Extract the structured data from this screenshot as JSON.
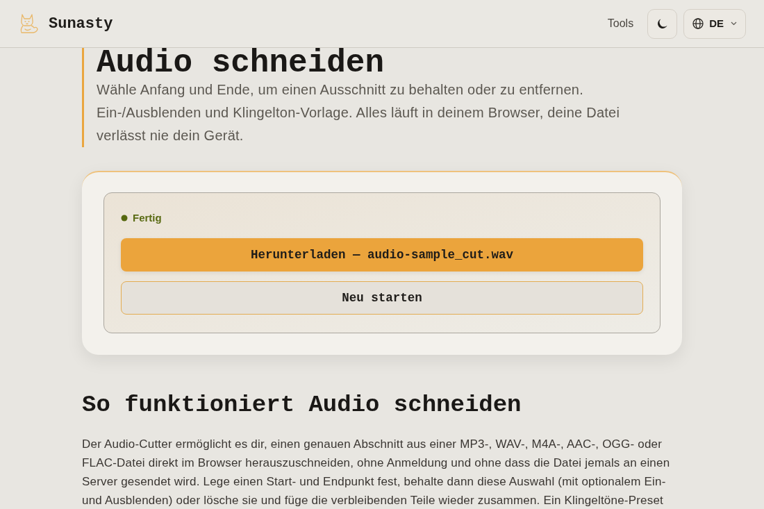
{
  "header": {
    "brand": "Sunasty",
    "nav": [
      {
        "label": "Tools"
      }
    ],
    "language": {
      "code": "DE"
    }
  },
  "hero": {
    "title": "Audio schneiden",
    "description": "Wähle Anfang und Ende, um einen Ausschnitt zu behalten oder zu entfernen. Ein-/Ausblenden und Klingelton-Vorlage. Alles läuft in deinem Browser, deine Datei verlässt nie dein Gerät."
  },
  "tool": {
    "status": {
      "label": "Fertig"
    },
    "buttons": [
      {
        "label": "Herunterladen — audio-sample_cut.wav",
        "kind": "primary"
      },
      {
        "label": "Neu starten",
        "kind": "secondary"
      }
    ]
  },
  "section": {
    "heading": "So funktioniert Audio schneiden",
    "paragraph": "Der Audio-Cutter ermöglicht es dir, einen genauen Abschnitt aus einer MP3-, WAV-, M4A-, AAC-, OGG- oder FLAC-Datei direkt im Browser herauszuschneiden, ohne Anmeldung und ohne dass die Datei jemals an einen Server gesendet wird. Lege einen Start- und Endpunkt fest, behalte dann diese Auswahl (mit optionalem Ein- und Ausblenden) oder lösche sie und füge die verbleibenden Teile wieder zusammen. Ein Klingeltöne-Preset"
  }
}
